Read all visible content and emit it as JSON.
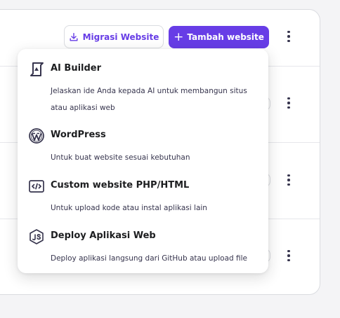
{
  "toolbar": {
    "migrate_label": "Migrasi Website",
    "add_label": "Tambah website"
  },
  "menu": {
    "items": [
      {
        "title": "AI Builder",
        "description": "Jelaskan ide Anda kepada AI untuk membangun situs atau aplikasi web",
        "icon": "ai-builder-icon"
      },
      {
        "title": "WordPress",
        "description": "Untuk buat website sesuai kebutuhan",
        "icon": "wordpress-icon"
      },
      {
        "title": "Custom website PHP/HTML",
        "description": "Untuk upload kode atau instal aplikasi lain",
        "icon": "code-icon"
      },
      {
        "title": "Deploy Aplikasi Web",
        "description": "Deploy aplikasi langsung dari GitHub atau upload file",
        "icon": "nodejs-icon"
      }
    ]
  },
  "colors": {
    "primary": "#673de6",
    "text": "#1d1e20",
    "muted": "#36344d",
    "border": "#dadce0",
    "background": "#f4f4f6"
  }
}
